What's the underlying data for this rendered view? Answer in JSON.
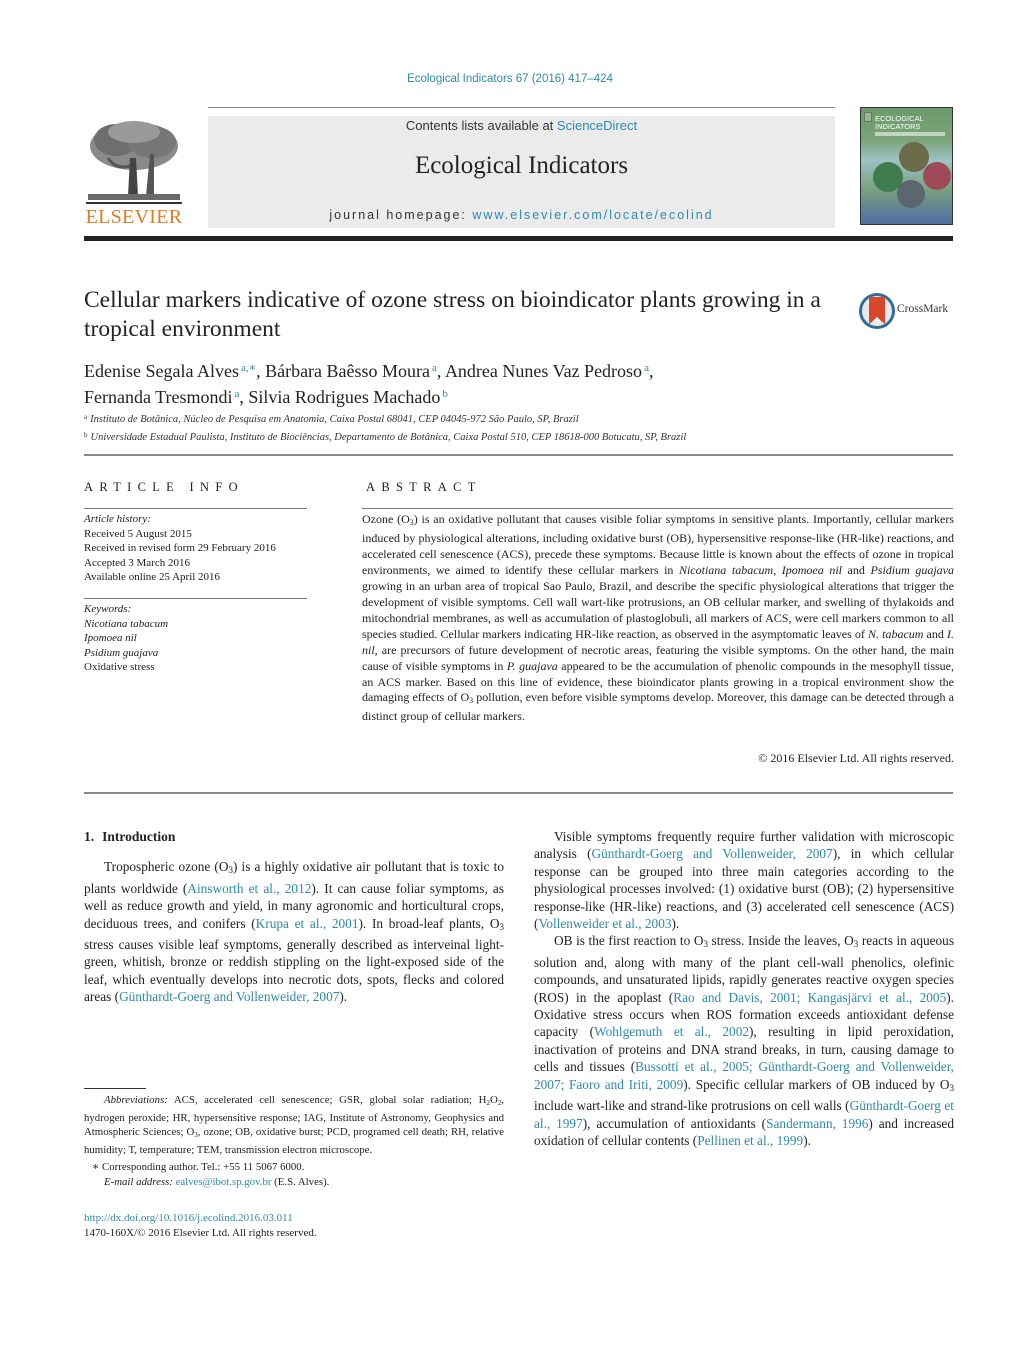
{
  "citation": "Ecological Indicators 67 (2016) 417–424",
  "masthead": {
    "contents_prefix": "Contents lists available at ",
    "contents_link": "ScienceDirect",
    "journal_name": "Ecological Indicators",
    "homepage_prefix": "journal homepage: ",
    "homepage_link": "www.elsevier.com/locate/ecolind",
    "publisher_logo_text": "ELSEVIER",
    "cover_title_line1": "ECOLOGICAL",
    "cover_title_line2": "INDICATORS"
  },
  "colors": {
    "link": "#2a8bb0",
    "elsevier_orange": "#e87a1d",
    "masthead_bg": "#ebebeb"
  },
  "article": {
    "title": "Cellular markers indicative of ozone stress on bioindicator plants growing in a tropical environment",
    "crossmark_label": "CrossMark",
    "authors": [
      {
        "name": "Edenise Segala Alves",
        "sup": "a,∗",
        "sep": ", "
      },
      {
        "name": "Bárbara Baêsso Moura",
        "sup": "a",
        "sep": ", "
      },
      {
        "name": "Andrea Nunes Vaz Pedroso",
        "sup": "a",
        "sep": ","
      },
      {
        "name": "Fernanda Tresmondi",
        "sup": "a",
        "sep": ", "
      },
      {
        "name": "Silvia Rodrigues Machado",
        "sup": "b",
        "sep": ""
      }
    ],
    "affiliations": [
      {
        "mark": "a",
        "text": "Instituto de Botânica, Núcleo de Pesquisa em Anatomia, Caixa Postal 68041, CEP 04045-972 São Paulo, SP, Brazil"
      },
      {
        "mark": "b",
        "text": "Universidade Estadual Paulista, Instituto de Biociências, Departamento de Botânica, Caixa Postal 510, CEP 18618-000 Botucatu, SP, Brazil"
      }
    ]
  },
  "article_info": {
    "heading": "ARTICLE INFO",
    "history_label": "Article history:",
    "history": [
      "Received 5 August 2015",
      "Received in revised form 29 February 2016",
      "Accepted 3 March 2016",
      "Available online 25 April 2016"
    ],
    "keywords_label": "Keywords:",
    "keywords": [
      {
        "text": "Nicotiana tabacum",
        "italic": true
      },
      {
        "text": "Ipomoea nil",
        "italic": true
      },
      {
        "text": "Psidium guajava",
        "italic": true
      },
      {
        "text": "Oxidative stress",
        "italic": false
      }
    ]
  },
  "abstract": {
    "heading": "ABSTRACT",
    "segments": [
      {
        "t": "Ozone (O"
      },
      {
        "t": "3",
        "sub": true
      },
      {
        "t": ") is an oxidative pollutant that causes visible foliar symptoms in sensitive plants. Importantly, cellular markers induced by physiological alterations, including oxidative burst (OB), hypersensitive response-like (HR-like) reactions, and accelerated cell senescence (ACS), precede these symptoms. Because little is known about the effects of ozone in tropical environments, we aimed to identify these cellular markers in "
      },
      {
        "t": "Nicotiana tabacum",
        "i": true
      },
      {
        "t": ", "
      },
      {
        "t": "Ipomoea nil",
        "i": true
      },
      {
        "t": " and "
      },
      {
        "t": "Psidium guajava",
        "i": true
      },
      {
        "t": " growing in an urban area of tropical Sao Paulo, Brazil, and describe the specific physiological alterations that trigger the development of visible symptoms. Cell wall wart-like protrusions, an OB cellular marker, and swelling of thylakoids and mitochondrial membranes, as well as accumulation of plastoglobuli, all markers of ACS, were cell markers common to all species studied. Cellular markers indicating HR-like reaction, as observed in the asymptomatic leaves of "
      },
      {
        "t": "N. tabacum",
        "i": true
      },
      {
        "t": " and "
      },
      {
        "t": "I. nil",
        "i": true
      },
      {
        "t": ", are precursors of future development of necrotic areas, featuring the visible symptoms. On the other hand, the main cause of visible symptoms in "
      },
      {
        "t": "P. guajava",
        "i": true
      },
      {
        "t": " appeared to be the accumulation of phenolic compounds in the mesophyll tissue, an ACS marker. Based on this line of evidence, these bioindicator plants growing in a tropical environment show the damaging effects of O"
      },
      {
        "t": "3",
        "sub": true
      },
      {
        "t": " pollution, even before visible symptoms develop. Moreover, this damage can be detected through a distinct group of cellular markers."
      }
    ],
    "copyright": "© 2016 Elsevier Ltd. All rights reserved."
  },
  "body": {
    "intro_number": "1.",
    "intro_title": "Introduction",
    "left_paragraphs": [
      [
        {
          "t": "Tropospheric ozone (O"
        },
        {
          "t": "3",
          "sub": true
        },
        {
          "t": ") is a highly oxidative air pollutant that is toxic to plants worldwide ("
        },
        {
          "t": "Ainsworth et al., 2012",
          "link": true
        },
        {
          "t": "). It can cause foliar symptoms, as well as reduce growth and yield, in many agronomic and horticultural crops, deciduous trees, and conifers ("
        },
        {
          "t": "Krupa et al., 2001",
          "link": true
        },
        {
          "t": "). In broad-leaf plants, O"
        },
        {
          "t": "3",
          "sub": true
        },
        {
          "t": " stress causes visible leaf symptoms, generally described as interveinal light-green, whitish, bronze or reddish stippling on the light-exposed side of the leaf, which eventually develops into necrotic dots, spots, flecks and colored areas ("
        },
        {
          "t": "Günthardt-Goerg and Vollenweider, 2007",
          "link": true
        },
        {
          "t": ")."
        }
      ]
    ],
    "right_paragraphs": [
      [
        {
          "t": "Visible symptoms frequently require further validation with microscopic analysis ("
        },
        {
          "t": "Günthardt-Goerg and Vollenweider, 2007",
          "link": true
        },
        {
          "t": "), in which cellular response can be grouped into three main categories according to the physiological processes involved: (1) oxidative burst (OB); (2) hypersensitive response-like (HR-like) reactions, and (3) accelerated cell senescence (ACS) ("
        },
        {
          "t": "Vollenweider et al., 2003",
          "link": true
        },
        {
          "t": ")."
        }
      ],
      [
        {
          "t": "OB is the first reaction to O"
        },
        {
          "t": "3",
          "sub": true
        },
        {
          "t": " stress. Inside the leaves, O"
        },
        {
          "t": "3",
          "sub": true
        },
        {
          "t": " reacts in aqueous solution and, along with many of the plant cell-wall phenolics, olefinic compounds, and unsaturated lipids, rapidly generates reactive oxygen species (ROS) in the apoplast ("
        },
        {
          "t": "Rao and Davis, 2001; Kangasjärvi et al., 2005",
          "link": true
        },
        {
          "t": "). Oxidative stress occurs when ROS formation exceeds antioxidant defense capacity ("
        },
        {
          "t": "Wohlgemuth et al., 2002",
          "link": true
        },
        {
          "t": "), resulting in lipid peroxidation, inactivation of proteins and DNA strand breaks, in turn, causing damage to cells and tissues ("
        },
        {
          "t": "Bussotti et al., 2005; Günthardt-Goerg and Vollenweider, 2007; Faoro and Iriti, 2009",
          "link": true
        },
        {
          "t": "). Specific cellular markers of OB induced by O"
        },
        {
          "t": "3",
          "sub": true
        },
        {
          "t": " include wart-like and strand-like protrusions on cell walls ("
        },
        {
          "t": "Günthardt-Goerg et al., 1997",
          "link": true
        },
        {
          "t": "), accumulation of antioxidants ("
        },
        {
          "t": "Sandermann, 1996",
          "link": true
        },
        {
          "t": ") and increased oxidation of cellular contents ("
        },
        {
          "t": "Pellinen et al., 1999",
          "link": true
        },
        {
          "t": ")."
        }
      ]
    ]
  },
  "footnotes": {
    "abbreviations_label": "Abbreviations:",
    "abbreviations": [
      {
        "t": "  ACS, accelerated cell senescence; GSR, global solar radiation; H"
      },
      {
        "t": "2",
        "sub": true
      },
      {
        "t": "O"
      },
      {
        "t": "2",
        "sub": true
      },
      {
        "t": ", hydrogen peroxide; HR, hypersensitive response; IAG, Institute of Astronomy, Geophysics and Atmospheric Sciences; O"
      },
      {
        "t": "3",
        "sub": true
      },
      {
        "t": ", ozone; OB, oxidative burst; PCD, programed cell death; RH, relative humidity; T, temperature; TEM, transmission electron microscope."
      }
    ],
    "corresponding": "∗  Corresponding author. Tel.: +55 11 5067 6000.",
    "email_label": "E-mail address: ",
    "email": "ealves@ibot.sp.gov.br",
    "email_suffix": " (E.S. Alves).",
    "doi": "http://dx.doi.org/10.1016/j.ecolind.2016.03.011",
    "issn_line": "1470-160X/© 2016 Elsevier Ltd. All rights reserved."
  }
}
